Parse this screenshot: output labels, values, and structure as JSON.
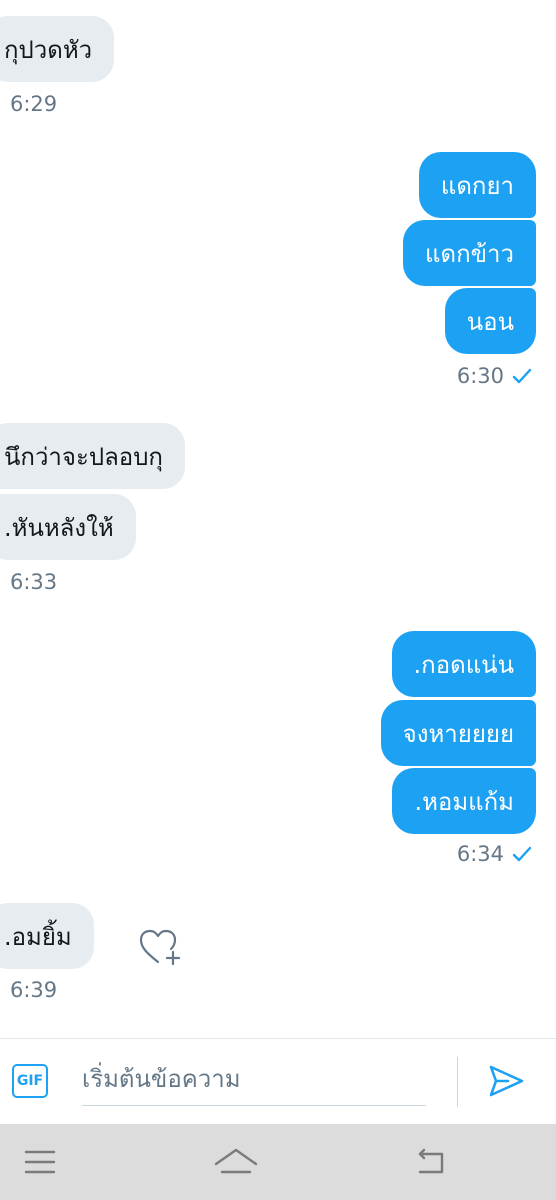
{
  "messages": {
    "m1": {
      "text": "กุปวดหัว",
      "time": "6:29"
    },
    "m2": {
      "lines": [
        "แดกยา",
        "แดกข้าว",
        "นอน"
      ],
      "time": "6:30"
    },
    "m3": {
      "lines": [
        "นึกว่าจะปลอบกุ",
        ".หันหลังให้"
      ],
      "time": "6:33"
    },
    "m4": {
      "lines": [
        ".กอดแน่น",
        "จงหายยยย",
        ".หอมแก้ม"
      ],
      "time": "6:34"
    },
    "m5": {
      "text": ".อมยิ้ม",
      "time": "6:39"
    }
  },
  "composer": {
    "gif_label": "GIF",
    "placeholder": "เริ่มต้นข้อความ",
    "value": ""
  },
  "icons": {
    "check": "check-icon",
    "heart": "heart-plus-icon",
    "send": "send-icon",
    "menu": "menu-icon",
    "home": "home-icon",
    "back": "back-icon"
  },
  "colors": {
    "accent": "#1da1f2",
    "incoming_bubble": "#e6ecf0",
    "timestamp": "#657786",
    "nav_bar": "#dcdcdc"
  }
}
